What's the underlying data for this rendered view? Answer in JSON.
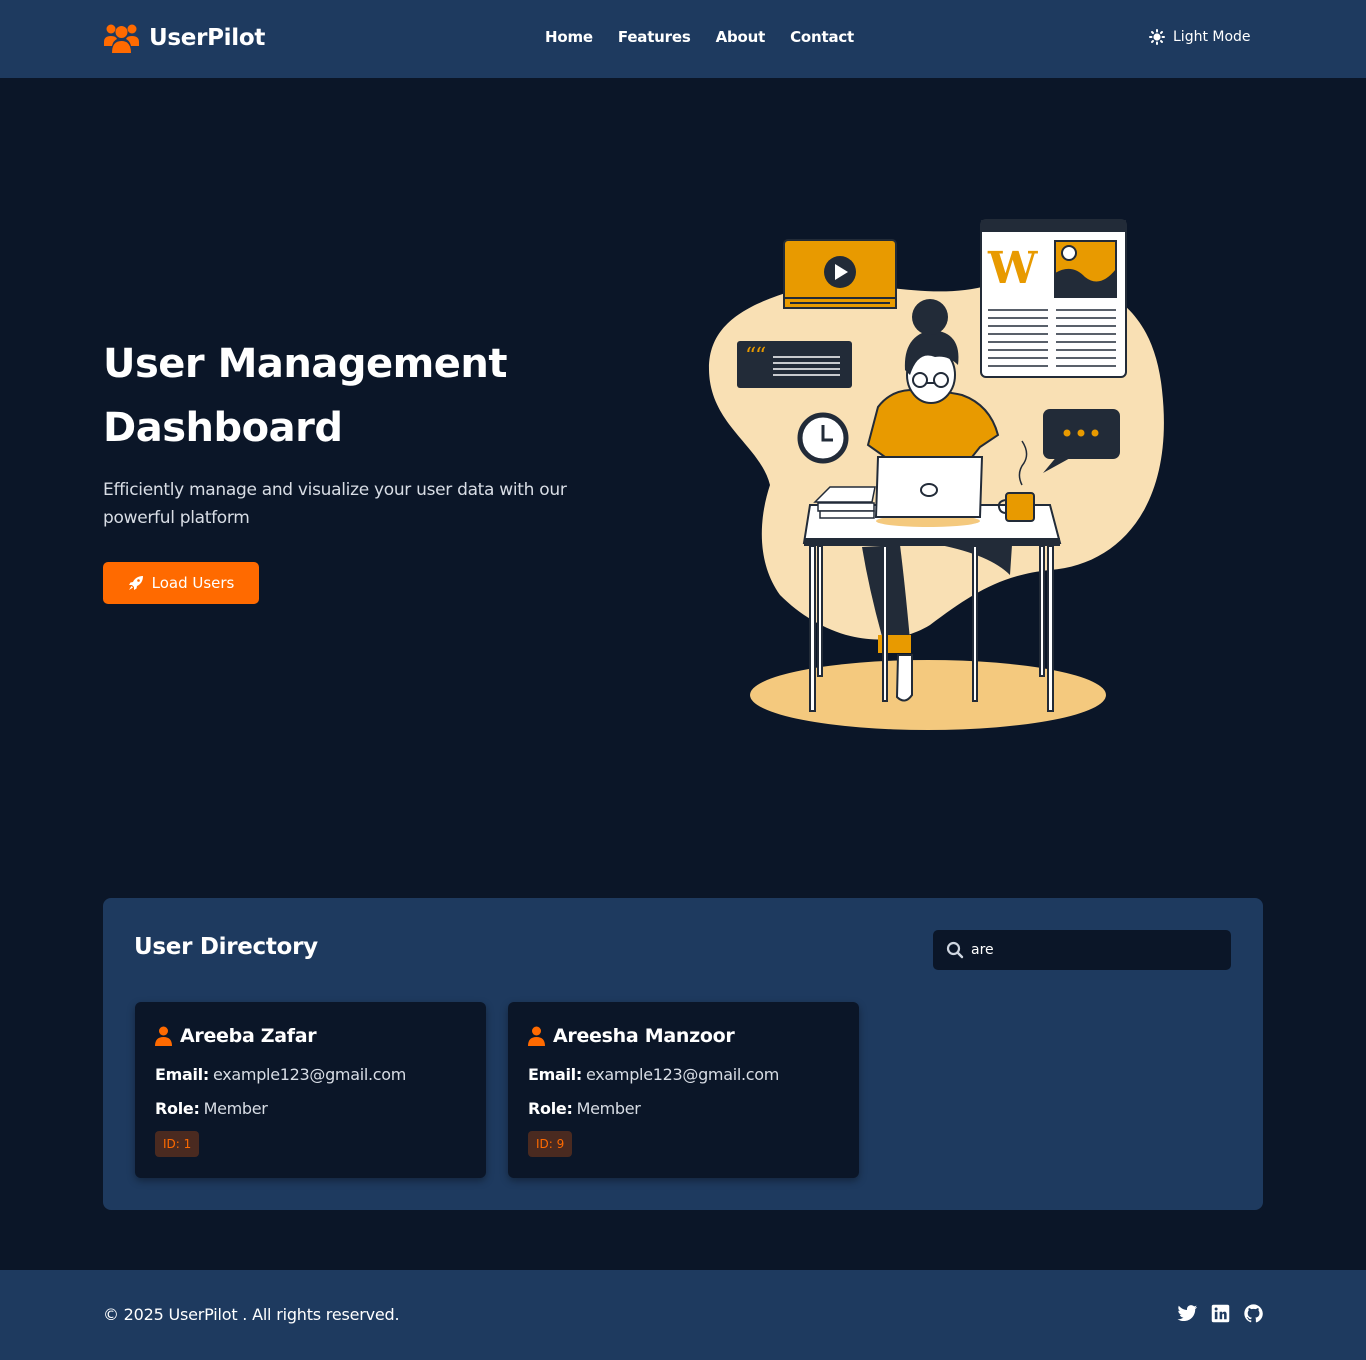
{
  "brand": {
    "name": "UserPilot",
    "icon": "users-icon",
    "accent": "#ff6a00"
  },
  "nav": {
    "links": [
      {
        "label": "Home"
      },
      {
        "label": "Features"
      },
      {
        "label": "About"
      },
      {
        "label": "Contact"
      }
    ],
    "mode_toggle": {
      "label": "Light Mode",
      "icon": "sun-icon"
    }
  },
  "hero": {
    "title": "User Management Dashboard",
    "subtitle": "Efficiently manage and visualize your user data with our powerful platform",
    "button_label": "Load Users",
    "button_icon": "rocket-icon",
    "illustration": "woman-at-desk-illustration"
  },
  "directory": {
    "title": "User Directory",
    "search": {
      "value": "are",
      "icon": "search-icon"
    },
    "users": [
      {
        "name": "Areeba Zafar",
        "email_label": "Email:",
        "email": "example123@gmail.com",
        "role_label": "Role:",
        "role": "Member",
        "id": "ID: 1"
      },
      {
        "name": "Areesha Manzoor",
        "email_label": "Email:",
        "email": "example123@gmail.com",
        "role_label": "Role:",
        "role": "Member",
        "id": "ID: 9"
      }
    ]
  },
  "footer": {
    "copyright": "© 2025 UserPilot . All rights reserved.",
    "socials": [
      "twitter-icon",
      "linkedin-icon",
      "github-icon"
    ]
  },
  "colors": {
    "navbar": "#1e3a5f",
    "background": "#0b1628",
    "accent": "#ff6a00",
    "illustration_blob": "#f9e0b4",
    "illustration_orange": "#e89a00"
  }
}
